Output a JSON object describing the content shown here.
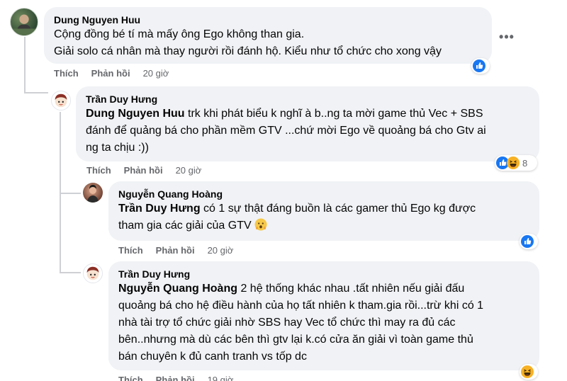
{
  "comments": [
    {
      "author": "Dung Nguyen Huu",
      "line1": "Cộng đồng bé tí mà mấy ông Ego không than gia.",
      "line2": "Giải solo cá nhân mà thay người rồi đánh hộ. Kiểu như tổ chức cho xong vậy",
      "like": "Thích",
      "reply": "Phản hồi",
      "time": "20 giờ",
      "reactions": [
        "like-icon"
      ]
    },
    {
      "author": "Trần Duy Hưng",
      "mention": "Dung Nguyen Huu",
      "text_a": " trk khi phát biểu k nghĩ à b..ng ta mời game thủ Vec + SBS",
      "text_b": "đánh để quảng bá cho phần mềm GTV ...chứ mời Ego về quoảng bá cho Gtv ai",
      "text_c": "ng ta chịu :))",
      "like": "Thích",
      "reply": "Phản hồi",
      "time": "20 giờ",
      "reactions": [
        "like-icon",
        "haha-icon"
      ],
      "reaction_count": "8"
    },
    {
      "author": "Nguyễn Quang Hoàng",
      "mention": "Trần Duy Hưng",
      "text_a": " có 1 sự thật đáng buồn là các gamer thủ Ego kg được",
      "text_b": "tham gia các giải của GTV",
      "emoji": "hushed-face-icon",
      "like": "Thích",
      "reply": "Phản hồi",
      "time": "20 giờ",
      "reactions": [
        "like-icon"
      ]
    },
    {
      "author": "Trần Duy Hưng",
      "mention": "Nguyễn Quang Hoàng",
      "text_a": " 2 hệ thống khác nhau .tất nhiên nếu giải đấu",
      "text_b": "quoảng bá cho hệ điều hành của họ tất nhiên k tham.gia rồi...trừ khi có 1",
      "text_c": "nhà tài trợ tổ chức giải nhờ SBS hay Vec tổ chức thì may ra đủ các",
      "text_d": "bên..nhưng mà dù các bên thì gtv lại k.có cửa ăn giải vì toàn game thủ",
      "text_e": "bán chuyên k đủ canh tranh vs tốp dc",
      "like": "Thích",
      "reply": "Phản hồi",
      "time": "19 giờ",
      "reactions": [
        "haha-icon"
      ]
    }
  ],
  "more_label": "•••",
  "colors": {
    "bubble": "#f0f2f5",
    "meta": "#65676b",
    "like_blue": "#1877f2",
    "haha_yellow": "#f7b125"
  }
}
